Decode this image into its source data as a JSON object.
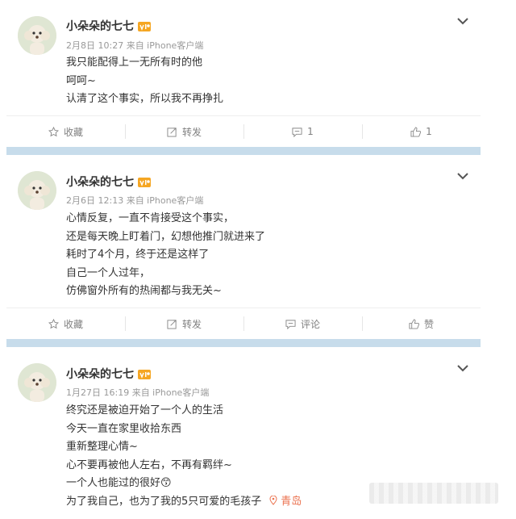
{
  "posts": [
    {
      "username": "小朵朵的七七",
      "meta": "2月8日 10:27 来自 iPhone客户端",
      "lines": [
        "我只能配得上一无所有时的他",
        "呵呵~",
        "认清了这个事实，所以我不再挣扎"
      ],
      "actions": {
        "favorite": "收藏",
        "repost": "转发",
        "comment": "1",
        "like": "1"
      }
    },
    {
      "username": "小朵朵的七七",
      "meta": "2月6日 12:13 来自 iPhone客户端",
      "lines": [
        "心情反复，一直不肯接受这个事实，",
        "还是每天晚上盯着门，幻想他推门就进来了",
        "耗时了4个月，终于还是这样了",
        "自己一个人过年，",
        "仿佛窗外所有的热闹都与我无关~"
      ],
      "actions": {
        "favorite": "收藏",
        "repost": "转发",
        "comment": "评论",
        "like": "赞"
      }
    },
    {
      "username": "小朵朵的七七",
      "meta": "1月27日 16:19 来自 iPhone客户端",
      "lines": [
        "终究还是被迫开始了一个人的生活",
        "今天一直在家里收拾东西",
        "重新整理心情~",
        "心不要再被他人左右，不再有羁绊~",
        "一个人也能过的很好😙",
        "为了我自己，也为了我的5只可爱的毛孩子"
      ],
      "location": "青岛"
    }
  ],
  "colors": {
    "separator": "#c7dceb",
    "location": "#eb7350",
    "meta": "#999999"
  }
}
